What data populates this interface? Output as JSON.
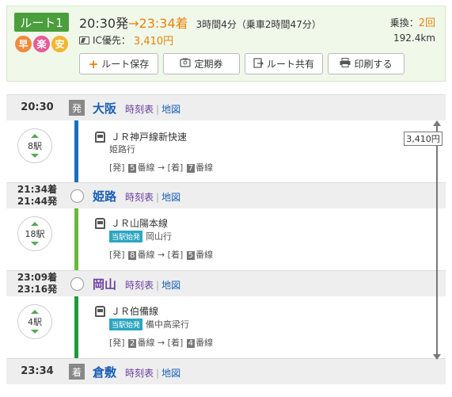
{
  "summary": {
    "route_label": "ルート1",
    "merits": [
      "早",
      "楽",
      "安"
    ],
    "depart_time": "20:30発",
    "arrow": "→",
    "arrive_time": "23:34着",
    "duration": "3時間4分（乗車2時間47分）",
    "fare_prefix": "IC優先：",
    "fare": "3,410円",
    "transfer_label": "乗換：",
    "transfer_count": "2回",
    "distance": "192.4km"
  },
  "actions": {
    "save": "ルート保存",
    "pass": "定期券",
    "share": "ルート共有",
    "print": "印刷する"
  },
  "stations": [
    {
      "time": "20:30",
      "time2": "",
      "tag": "発",
      "name": "大阪",
      "timetable": "時刻表",
      "map": "地図"
    },
    {
      "time": "21:34着",
      "time2": "21:44発",
      "tag": "",
      "name": "姫路",
      "timetable": "時刻表",
      "map": "地図"
    },
    {
      "time": "23:09着",
      "time2": "23:16発",
      "tag": "",
      "name": "岡山",
      "timetable": "時刻表",
      "map": "地図"
    },
    {
      "time": "23:34",
      "time2": "",
      "tag": "着",
      "name": "倉敷",
      "timetable": "時刻表",
      "map": "地図"
    }
  ],
  "segments": [
    {
      "stops": "8駅",
      "line": "ＪＲ神戸線新快速",
      "first_stop": "",
      "direction": "姫路行",
      "dep_prefix": "[発]",
      "dep_track": "5",
      "dep_suffix": "番線",
      "arr_prefix": "→ [着]",
      "arr_track": "7",
      "arr_suffix": "番線"
    },
    {
      "stops": "18駅",
      "line": "ＪＲ山陽本線",
      "first_stop": "当駅始発",
      "direction": "岡山行",
      "dep_prefix": "[発]",
      "dep_track": "8",
      "dep_suffix": "番線",
      "arr_prefix": "→ [着]",
      "arr_track": "5",
      "arr_suffix": "番線"
    },
    {
      "stops": "4駅",
      "line": "ＪＲ伯備線",
      "first_stop": "当駅始発",
      "direction": "備中高梁行",
      "dep_prefix": "[発]",
      "dep_track": "2",
      "dep_suffix": "番線",
      "arr_prefix": "→ [着]",
      "arr_track": "4",
      "arr_suffix": "番線"
    }
  ],
  "fare_marker": "3,410円",
  "colors": {
    "kobe_line": "#1a6fc0",
    "sanyo_line": "#6cb83e",
    "hakubi_line": "#1e9a3a",
    "accent": "#e8830c",
    "route_badge": "#4a9e3c"
  }
}
